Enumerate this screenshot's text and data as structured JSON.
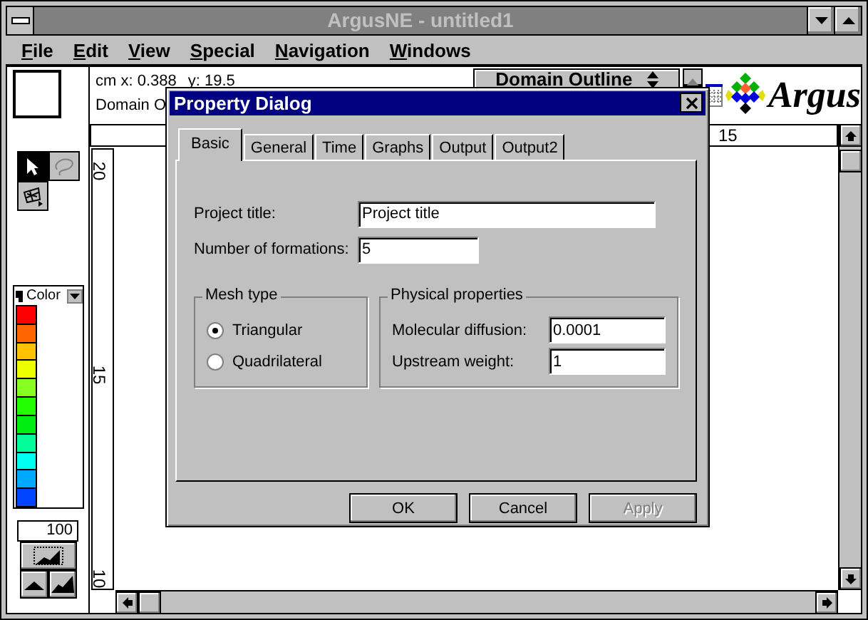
{
  "window": {
    "title": "ArgusNE - untitled1"
  },
  "menu": [
    "File",
    "Edit",
    "View",
    "Special",
    "Navigation",
    "Windows"
  ],
  "toolbar": {
    "cursor_x": "cm x: 0.388",
    "cursor_y": "y: 19.5",
    "layer_status": "Domain O",
    "layer_select": "Domain Outline",
    "logo": "Argus"
  },
  "tools": [
    {
      "kind": "pointer",
      "selected": true,
      "disabled": false
    },
    {
      "kind": "lasso",
      "selected": false,
      "disabled": true
    },
    {
      "kind": "mesh",
      "selected": false,
      "disabled": false
    }
  ],
  "palette": {
    "label": "Color",
    "swatches": [
      {
        "color": "#ff0000"
      },
      {
        "color": "#ff6600"
      },
      {
        "color": "#ffc000"
      },
      {
        "color": "#eeff00"
      },
      {
        "color": "#88ff22"
      },
      {
        "color": "#22ff00"
      },
      {
        "color": "#00ee11"
      },
      {
        "color": "#00ff99"
      },
      {
        "color": "#00ffee"
      },
      {
        "color": "#00a8ff"
      },
      {
        "color": "#0044ff"
      }
    ]
  },
  "zoom_field": {
    "value": "100"
  },
  "horizontal_ruler": {
    "labels": [
      "15"
    ]
  },
  "vertical_ruler": {
    "labels": [
      "20",
      "15",
      "10"
    ]
  },
  "dialog": {
    "title": "Property Dialog",
    "tabs": [
      {
        "label": "Basic",
        "selected": true
      },
      {
        "label": "General",
        "selected": false
      },
      {
        "label": "Time",
        "selected": false
      },
      {
        "label": "Graphs",
        "selected": false
      },
      {
        "label": "Output",
        "selected": false
      },
      {
        "label": "Output2",
        "selected": false
      }
    ],
    "fields": [
      {
        "label": "Project title:",
        "value": "Project title"
      },
      {
        "label": "Number of formations:",
        "value": "5"
      }
    ],
    "mesh_type": {
      "title": "Mesh type",
      "options": [
        {
          "label": "Triangular",
          "selected": true
        },
        {
          "label": "Quadrilateral",
          "selected": false
        }
      ]
    },
    "physical_properties": {
      "title": "Physical properties",
      "fields": [
        {
          "label": "Molecular diffusion:",
          "value": "0.0001"
        },
        {
          "label": "Upstream weight:",
          "value": "1"
        }
      ]
    },
    "buttons": [
      {
        "label": "OK",
        "disabled": false
      },
      {
        "label": "Cancel",
        "disabled": false
      },
      {
        "label": "Apply",
        "disabled": true
      }
    ]
  }
}
